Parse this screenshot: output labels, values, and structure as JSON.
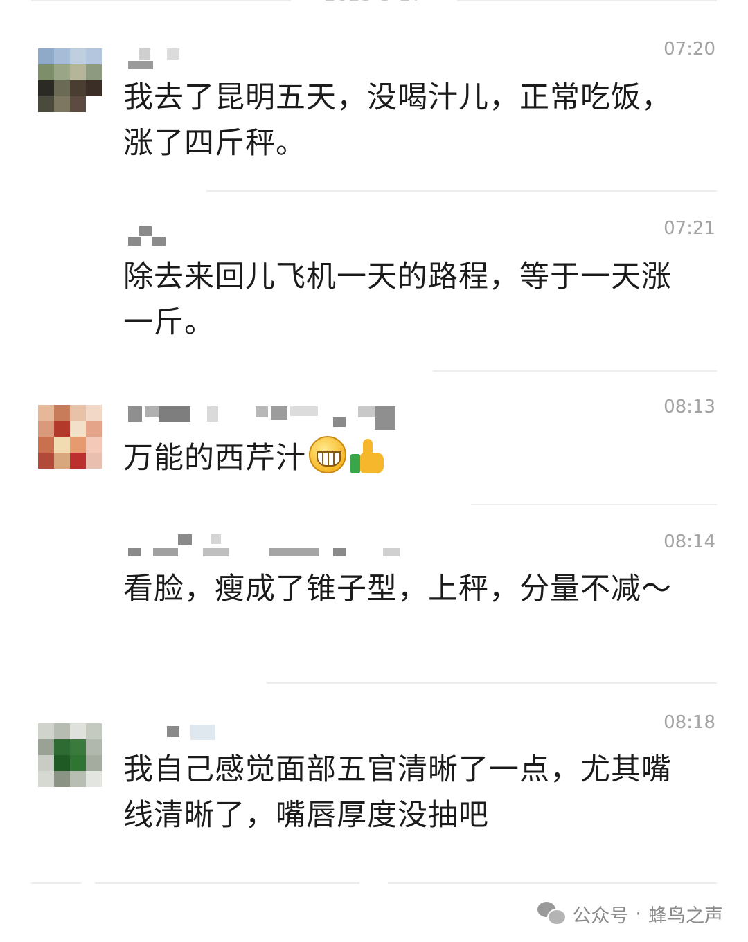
{
  "date_header": "2023-5-27",
  "messages": [
    {
      "time": "07:20",
      "text": "我去了昆明五天，没喝汁儿，正常吃饭，涨了四斤秤。"
    },
    {
      "time": "07:21",
      "text": "除去来回儿飞机一天的路程，等于一天涨一斤。"
    },
    {
      "time": "08:13",
      "text": "万能的西芹汁",
      "emojis": [
        "grinning-face-icon",
        "thumbs-up-icon"
      ]
    },
    {
      "time": "08:14",
      "text": "看脸，瘦成了锥子型，上秤，分量不减～"
    },
    {
      "time": "08:18",
      "text": "我自己感觉面部五官清晰了一点，尤其嘴线清晰了，嘴唇厚度没抽吧"
    }
  ],
  "footer": {
    "account_label": "公众号",
    "dot": "·",
    "account_name": "蜂鸟之声"
  },
  "colors": {
    "text": "#1b1b1b",
    "time": "#a3a3a3",
    "separator": "#ededed",
    "background": "#ffffff"
  }
}
